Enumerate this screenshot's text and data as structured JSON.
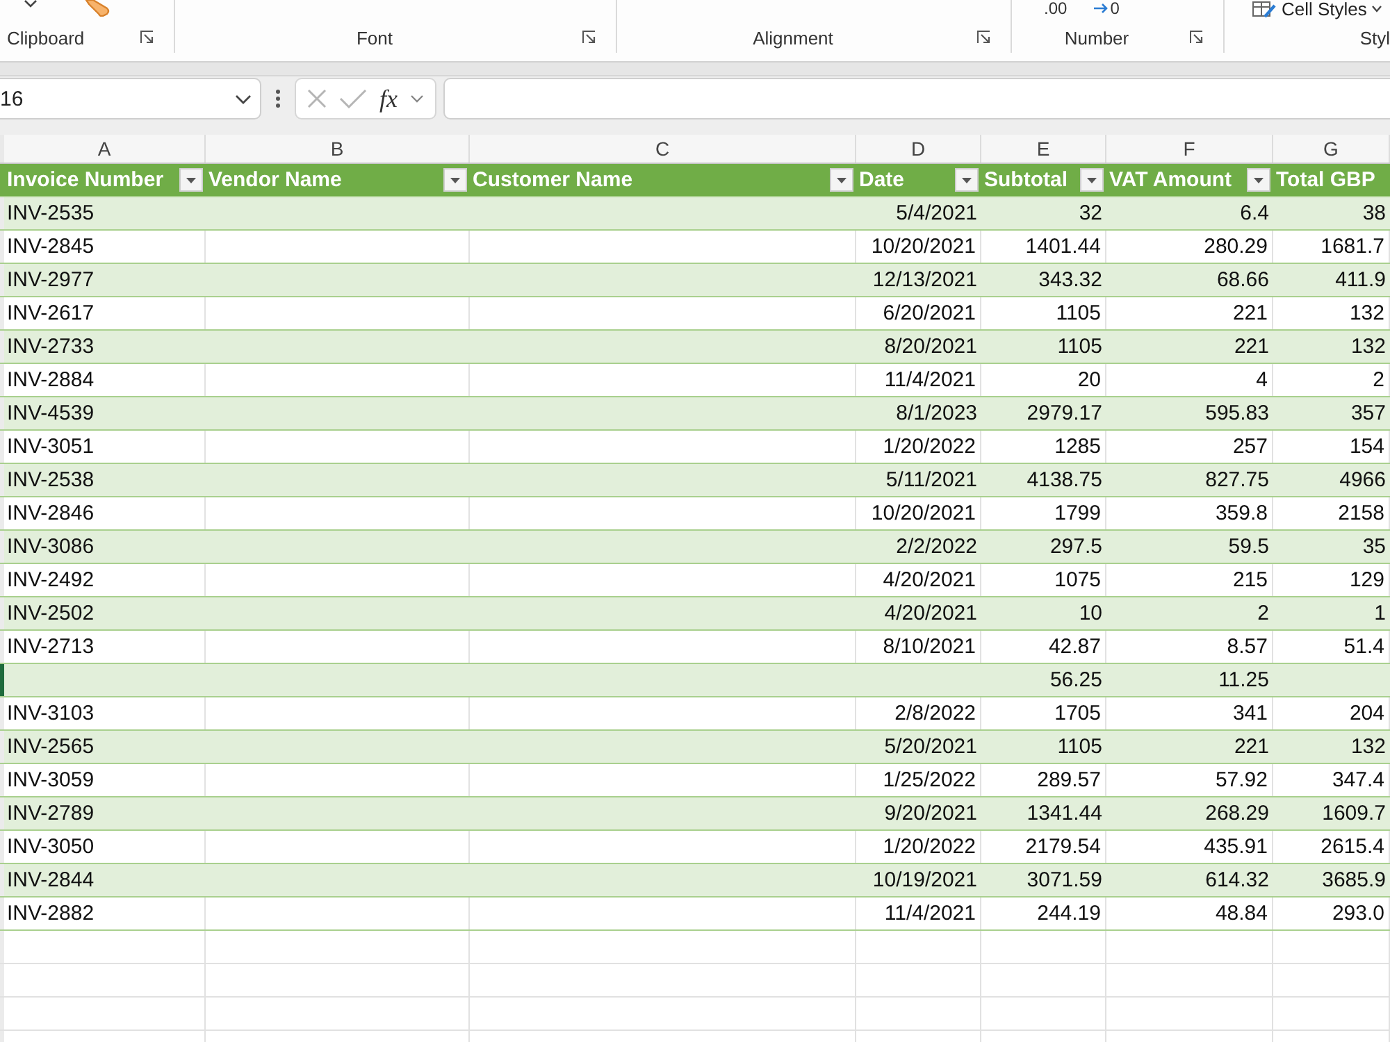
{
  "ribbon": {
    "groups": [
      {
        "kind": "clipboard",
        "label": "Clipboard",
        "launcher": true
      },
      {
        "kind": "font",
        "label": "Font",
        "launcher": true
      },
      {
        "kind": "alignment",
        "label": "Alignment",
        "launcher": true
      },
      {
        "kind": "number",
        "label": "Number",
        "launcher": true,
        "buttons": [
          ".00",
          "0"
        ]
      },
      {
        "kind": "styles",
        "label": "Styl",
        "launcher": false,
        "buttons": [
          "Cell Styles"
        ]
      }
    ]
  },
  "formula_bar": {
    "name_box": "16",
    "function_label": "fx"
  },
  "column_headers": [
    "A",
    "B",
    "C",
    "D",
    "E",
    "F",
    "G"
  ],
  "table": {
    "columns": [
      {
        "label": "Invoice Number",
        "filter": true
      },
      {
        "label": "Vendor Name",
        "filter": true
      },
      {
        "label": "Customer Name",
        "filter": true
      },
      {
        "label": "Date",
        "filter": true
      },
      {
        "label": "Subtotal",
        "filter": true
      },
      {
        "label": "VAT Amount",
        "filter": true
      },
      {
        "label": "Total GBP",
        "filter": false
      }
    ],
    "rows": [
      {
        "invoice_number": "INV-2535",
        "date": "5/4/2021",
        "subtotal": "32",
        "vat_amount": "6.4",
        "total_gbp": "38",
        "selected": false
      },
      {
        "invoice_number": "INV-2845",
        "date": "10/20/2021",
        "subtotal": "1401.44",
        "vat_amount": "280.29",
        "total_gbp": "1681.7",
        "selected": false
      },
      {
        "invoice_number": "INV-2977",
        "date": "12/13/2021",
        "subtotal": "343.32",
        "vat_amount": "68.66",
        "total_gbp": "411.9",
        "selected": false
      },
      {
        "invoice_number": "INV-2617",
        "date": "6/20/2021",
        "subtotal": "1105",
        "vat_amount": "221",
        "total_gbp": "132",
        "selected": false
      },
      {
        "invoice_number": "INV-2733",
        "date": "8/20/2021",
        "subtotal": "1105",
        "vat_amount": "221",
        "total_gbp": "132",
        "selected": false
      },
      {
        "invoice_number": "INV-2884",
        "date": "11/4/2021",
        "subtotal": "20",
        "vat_amount": "4",
        "total_gbp": "2",
        "selected": false
      },
      {
        "invoice_number": "INV-4539",
        "date": "8/1/2023",
        "subtotal": "2979.17",
        "vat_amount": "595.83",
        "total_gbp": "357",
        "selected": false
      },
      {
        "invoice_number": "INV-3051",
        "date": "1/20/2022",
        "subtotal": "1285",
        "vat_amount": "257",
        "total_gbp": "154",
        "selected": false
      },
      {
        "invoice_number": "INV-2538",
        "date": "5/11/2021",
        "subtotal": "4138.75",
        "vat_amount": "827.75",
        "total_gbp": "4966",
        "selected": false
      },
      {
        "invoice_number": "INV-2846",
        "date": "10/20/2021",
        "subtotal": "1799",
        "vat_amount": "359.8",
        "total_gbp": "2158",
        "selected": false
      },
      {
        "invoice_number": "INV-3086",
        "date": "2/2/2022",
        "subtotal": "297.5",
        "vat_amount": "59.5",
        "total_gbp": "35",
        "selected": false
      },
      {
        "invoice_number": "INV-2492",
        "date": "4/20/2021",
        "subtotal": "1075",
        "vat_amount": "215",
        "total_gbp": "129",
        "selected": false
      },
      {
        "invoice_number": "INV-2502",
        "date": "4/20/2021",
        "subtotal": "10",
        "vat_amount": "2",
        "total_gbp": "1",
        "selected": false
      },
      {
        "invoice_number": "INV-2713",
        "date": "8/10/2021",
        "subtotal": "42.87",
        "vat_amount": "8.57",
        "total_gbp": "51.4",
        "selected": false
      },
      {
        "subtotal": "56.25",
        "vat_amount": "11.25",
        "selected": true
      },
      {
        "invoice_number": "INV-3103",
        "date": "2/8/2022",
        "subtotal": "1705",
        "vat_amount": "341",
        "total_gbp": "204",
        "selected": false
      },
      {
        "invoice_number": "INV-2565",
        "date": "5/20/2021",
        "subtotal": "1105",
        "vat_amount": "221",
        "total_gbp": "132",
        "selected": false
      },
      {
        "invoice_number": "INV-3059",
        "date": "1/25/2022",
        "subtotal": "289.57",
        "vat_amount": "57.92",
        "total_gbp": "347.4",
        "selected": false
      },
      {
        "invoice_number": "INV-2789",
        "date": "9/20/2021",
        "subtotal": "1341.44",
        "vat_amount": "268.29",
        "total_gbp": "1609.7",
        "selected": false
      },
      {
        "invoice_number": "INV-3050",
        "date": "1/20/2022",
        "subtotal": "2179.54",
        "vat_amount": "435.91",
        "total_gbp": "2615.4",
        "selected": false
      },
      {
        "invoice_number": "INV-2844",
        "date": "10/19/2021",
        "subtotal": "3071.59",
        "vat_amount": "614.32",
        "total_gbp": "3685.9",
        "selected": false
      },
      {
        "invoice_number": "INV-2882",
        "date": "11/4/2021",
        "subtotal": "244.19",
        "vat_amount": "48.84",
        "total_gbp": "293.0",
        "selected": false
      }
    ]
  }
}
